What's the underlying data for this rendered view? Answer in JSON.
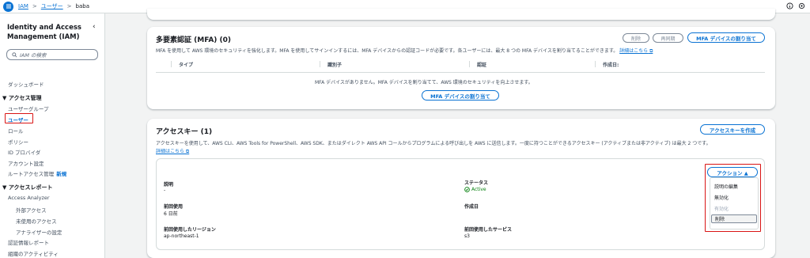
{
  "breadcrumb": {
    "items": [
      "IAM",
      "ユーザー"
    ],
    "current": "baba"
  },
  "sidebar": {
    "title": "Identity and Access Management (IAM)",
    "search_placeholder": "IAM の検索",
    "dashboard": "ダッシュボード",
    "access_mgmt": "▼ アクセス管理",
    "user_groups": "ユーザーグループ",
    "users": "ユーザー",
    "roles": "ロール",
    "policies": "ポリシー",
    "id_providers": "ID プロバイダ",
    "account_settings": "アカウント設定",
    "root_access": "ルートアクセス管理",
    "new_badge": "新規",
    "access_reports": "▼ アクセスレポート",
    "access_analyzer": "Access Analyzer",
    "external_access": "外部アクセス",
    "unused_access": "未使用のアクセス",
    "analyzer_settings": "アナライザーの設定",
    "credential_report": "認証情報レポート",
    "org_activity": "組織のアクティビティ"
  },
  "mfa": {
    "title": "多要素認証 (MFA) (0)",
    "delete_btn": "削除",
    "resync_btn": "再同期",
    "assign_btn": "MFA デバイスの割り当て",
    "description": "MFA を使用して AWS 環境のセキュリティを強化します。MFA を使用してサインインするには、MFA デバイスからの認証コードが必要です。各ユーザーには、最大 8 つの MFA デバイスを割り当てることができます。",
    "learn_more": "詳細はこちら",
    "columns": [
      "タイプ",
      "識別子",
      "認証",
      "作成日:"
    ],
    "empty_message": "MFA デバイスがありません。MFA デバイスを割り当てて、AWS 環境のセキュリティを向上させます。",
    "empty_assign_btn": "MFA デバイスの割り当て"
  },
  "access_keys": {
    "title": "アクセスキー (1)",
    "create_btn": "アクセスキーを作成",
    "description": "アクセスキーを使用して、AWS CLI、AWS Tools for PowerShell、AWS SDK、またはダイレクト AWS API コールからプログラムによる呼び出しを AWS に送信します。一度に持つことができるアクセスキー (アクティブまたは非アクティブ) は最大 2 つです。",
    "learn_more": "詳細はこちら",
    "card": {
      "description_label": "説明",
      "description_value": "-",
      "last_used_label": "前回使用",
      "last_used_value": "6 日前",
      "last_region_label": "前回使用したリージョン",
      "last_region_value": "ap-northeast-1",
      "status_label": "ステータス",
      "status_value": "Active",
      "created_label": "作成日",
      "last_service_label": "前回使用したサービス",
      "last_service_value": "s3"
    },
    "actions_btn": "アクション ▲",
    "actions_menu": [
      "説明の編集",
      "無効化",
      "有効化",
      "削除"
    ]
  },
  "colors": {
    "accent": "#0972d3",
    "highlight": "#d91515",
    "success": "#037f0c"
  }
}
